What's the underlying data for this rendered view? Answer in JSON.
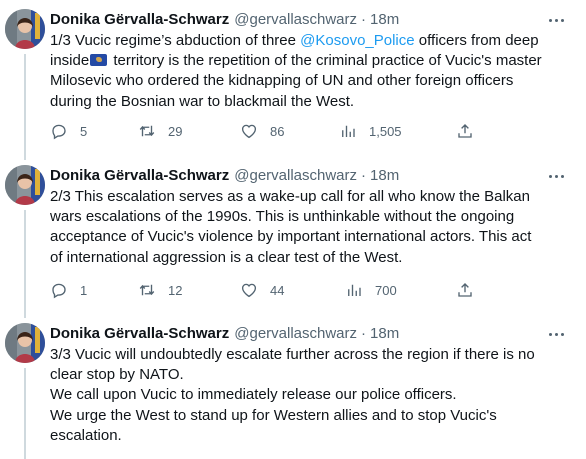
{
  "tweets": [
    {
      "author": {
        "name": "Donika Gërvalla-Schwarz",
        "handle": "@gervallaschwarz",
        "separator": "·",
        "time": "18m"
      },
      "lines": [
        {
          "pre": "1/3 Vucic regime’s abduction of three ",
          "mention": "@Kosovo_Police",
          "post": " officers from deep"
        },
        {
          "pre": "inside",
          "flag": true,
          "post": " territory is the repetition of the criminal practice of Vucic's master"
        },
        {
          "pre": "Milosevic who ordered the kidnapping of UN and other foreign officers"
        },
        {
          "pre": "during the Bosnian war to blackmail the West."
        }
      ],
      "stats": {
        "replies": "5",
        "retweets": "29",
        "likes": "86",
        "views": "1,505"
      }
    },
    {
      "author": {
        "name": "Donika Gërvalla-Schwarz",
        "handle": "@gervallaschwarz",
        "separator": "·",
        "time": "18m"
      },
      "lines": [
        {
          "pre": "2/3 This escalation serves as a wake-up call for all who know the Balkan"
        },
        {
          "pre": "wars escalations of the 1990s. This is unthinkable without the ongoing"
        },
        {
          "pre": "acceptance of Vucic's violence by important international actors. This act"
        },
        {
          "pre": "of international aggression is a clear test of the West."
        }
      ],
      "stats": {
        "replies": "1",
        "retweets": "12",
        "likes": "44",
        "views": "700"
      }
    },
    {
      "author": {
        "name": "Donika Gërvalla-Schwarz",
        "handle": "@gervallaschwarz",
        "separator": "·",
        "time": "18m"
      },
      "lines": [
        {
          "pre": "3/3 Vucic will undoubtedly escalate further across the region if there is no"
        },
        {
          "pre": "clear stop by NATO."
        },
        {
          "pre": "We call upon Vucic to immediately release our police officers."
        },
        {
          "pre": "We urge the West to stand up for Western allies and to stop Vucic's"
        },
        {
          "pre": "escalation."
        }
      ]
    }
  ],
  "icons": {
    "reply": "reply-icon",
    "retweet": "retweet-icon",
    "like": "like-icon",
    "views": "views-icon",
    "share": "share-icon",
    "more": "more-icon",
    "flag": "kosovo-flag-icon"
  },
  "colors": {
    "link": "#1d9bf0",
    "text": "#0f1419",
    "muted": "#536471",
    "thread_line": "#cfd9de",
    "flag_blue": "#244aa5",
    "flag_gold": "#d0a650"
  }
}
